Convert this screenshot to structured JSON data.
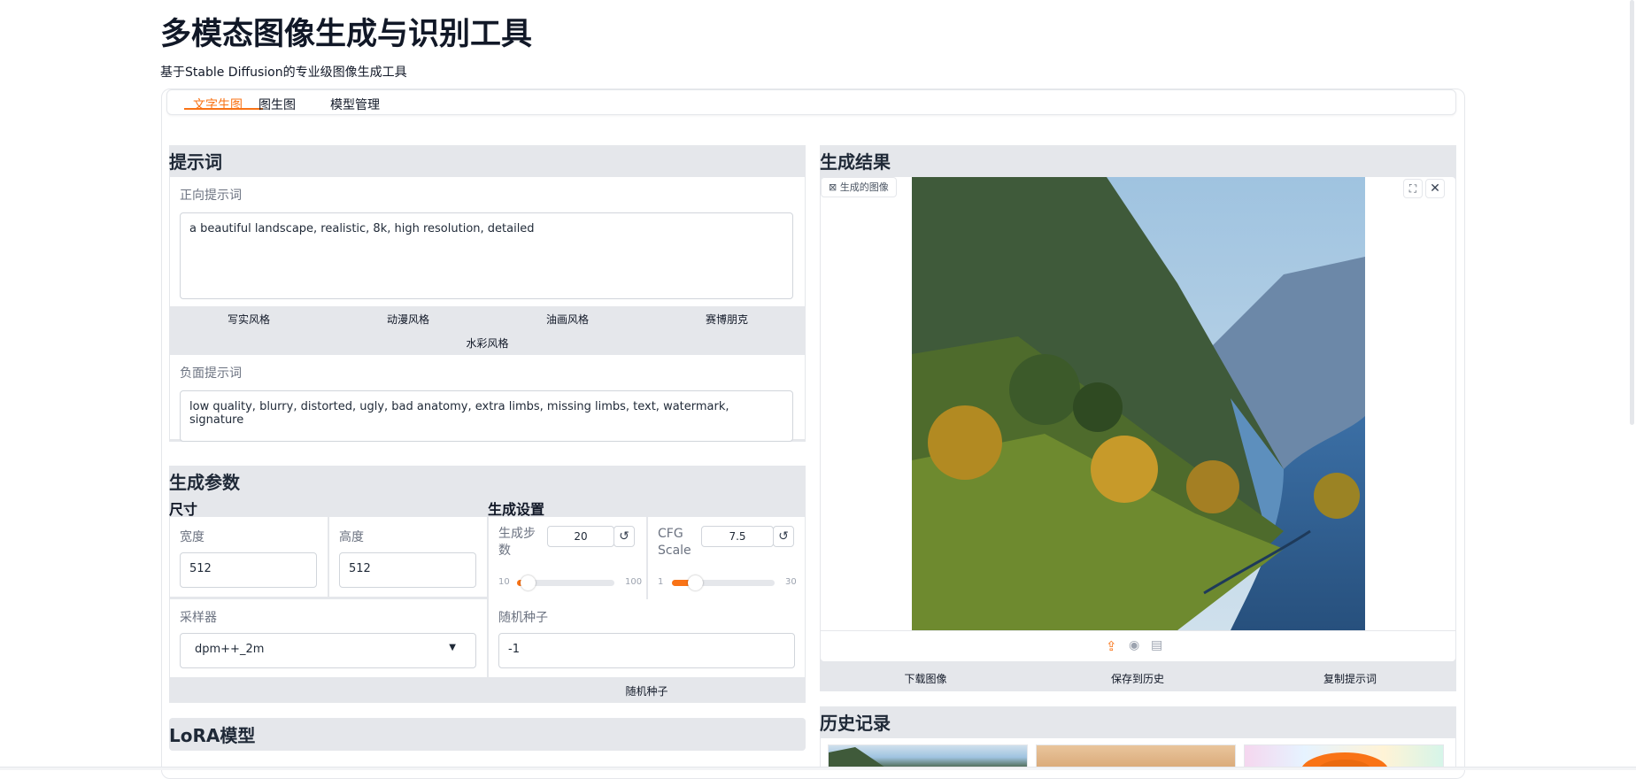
{
  "header": {
    "title": "多模态图像生成与识别工具",
    "subtitle": "基于Stable Diffusion的专业级图像生成工具"
  },
  "tabs": [
    {
      "label": "文字生图",
      "active": true
    },
    {
      "label": "图生图",
      "active": false
    },
    {
      "label": "模型管理",
      "active": false
    }
  ],
  "prompt": {
    "section_title": "提示词",
    "positive_label": "正向提示词",
    "positive_value": "a beautiful landscape, realistic, 8k, high resolution, detailed",
    "style_buttons": [
      "写实风格",
      "动漫风格",
      "油画风格",
      "赛博朋克",
      "水彩风格"
    ],
    "negative_label": "负面提示词",
    "negative_value": "low quality, blurry, distorted, ugly, bad anatomy, extra limbs, missing limbs, text, watermark, signature"
  },
  "params": {
    "section_title": "生成参数",
    "size_heading": "尺寸",
    "settings_heading": "生成设置",
    "width_label": "宽度",
    "width_value": "512",
    "height_label": "高度",
    "height_value": "512",
    "steps_label": "生成步数",
    "steps_value": "20",
    "steps_min": "10",
    "steps_max": "100",
    "steps_fraction": 0.11,
    "cfg_label": "CFG Scale",
    "cfg_value": "7.5",
    "cfg_min": "1",
    "cfg_max": "30",
    "cfg_fraction": 0.22,
    "sampler_label": "采样器",
    "sampler_value": "dpm++_2m",
    "seed_label": "随机种子",
    "seed_value": "-1",
    "random_seed_button": "随机种子"
  },
  "lora": {
    "section_title": "LoRA模型"
  },
  "result": {
    "section_title": "生成结果",
    "image_label": "生成的图像",
    "download_button": "下载图像",
    "save_button": "保存到历史",
    "copy_button": "复制提示词"
  },
  "history": {
    "section_title": "历史记录"
  },
  "icons": {
    "image_label": "image-icon",
    "fullscreen": "fullscreen-icon",
    "close": "close-icon",
    "upload": "upload-icon",
    "webcam": "webcam-icon",
    "clipboard": "clipboard-icon",
    "reset": "reset-icon",
    "dropdown": "chevron-down-icon"
  },
  "colors": {
    "accent": "#f97316",
    "panel": "#e5e7eb"
  }
}
